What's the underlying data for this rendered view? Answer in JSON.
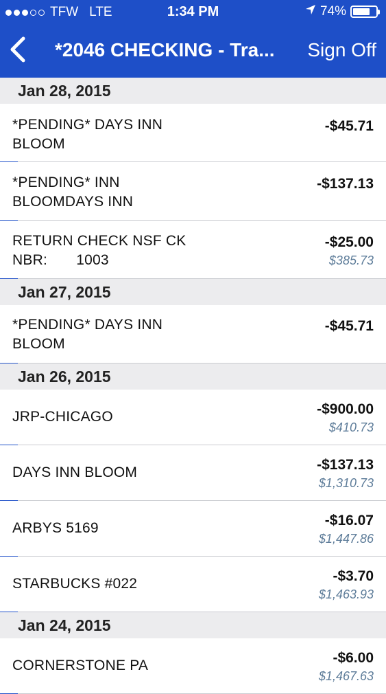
{
  "status_bar": {
    "carrier": "TFW",
    "network": "LTE",
    "time": "1:34 PM",
    "battery": "74%",
    "battery_level": 0.74,
    "signal_bars_filled": 3,
    "signal_bars_total": 5
  },
  "nav": {
    "back_icon": "chevron-left-icon",
    "title": "*2046 CHECKING - Tra...",
    "sign_off_label": "Sign Off"
  },
  "colors": {
    "brand": "#1e4fc8",
    "section_bg": "#ececee",
    "balance": "#5d7c99"
  },
  "sections": [
    {
      "date": "Jan 28, 2015",
      "rows": [
        {
          "desc": "*PENDING* DAYS INN\nBLOOM",
          "amount": "-$45.71",
          "balance": ""
        },
        {
          "desc": "*PENDING* INN\nBLOOMDAYS INN",
          "amount": "-$137.13",
          "balance": ""
        },
        {
          "desc": "RETURN CHECK NSF CK\nNBR:       1003",
          "amount": "-$25.00",
          "balance": "$385.73"
        }
      ]
    },
    {
      "date": "Jan 27, 2015",
      "rows": [
        {
          "desc": "*PENDING* DAYS INN\nBLOOM",
          "amount": "-$45.71",
          "balance": ""
        }
      ]
    },
    {
      "date": "Jan 26, 2015",
      "rows": [
        {
          "desc": "JRP-CHICAGO",
          "amount": "-$900.00",
          "balance": "$410.73"
        },
        {
          "desc": "DAYS INN BLOOM",
          "amount": "-$137.13",
          "balance": "$1,310.73"
        },
        {
          "desc": "ARBYS 5169",
          "amount": "-$16.07",
          "balance": "$1,447.86"
        },
        {
          "desc": "STARBUCKS #022",
          "amount": "-$3.70",
          "balance": "$1,463.93"
        }
      ]
    },
    {
      "date": "Jan 24, 2015",
      "rows": [
        {
          "desc": "CORNERSTONE PA",
          "amount": "-$6.00",
          "balance": "$1,467.63"
        }
      ]
    }
  ]
}
